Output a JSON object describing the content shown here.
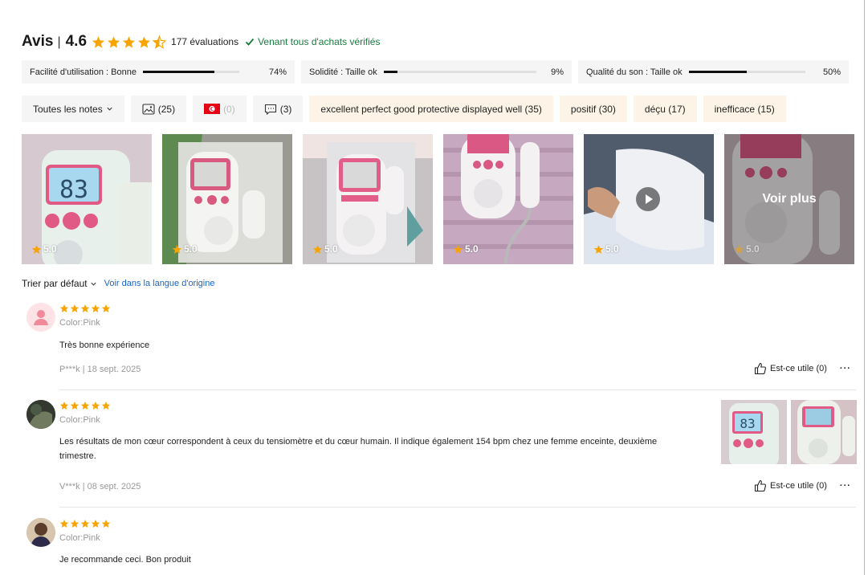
{
  "header": {
    "title": "Avis",
    "separator": "|",
    "score": "4.6",
    "count_text": "177 évaluations",
    "verified_text": "Venant tous d'achats vérifiés",
    "star_color": "#f7a400",
    "verified_color": "#187b3e"
  },
  "attributes": [
    {
      "label": "Facilité d'utilisation : Bonne",
      "percent": "74%",
      "level": 0.74
    },
    {
      "label": "Solidité : Taille ok",
      "percent": "9%",
      "level": 0.09
    },
    {
      "label": "Qualité du son : Taille ok",
      "percent": "50%",
      "level": 0.5
    }
  ],
  "filters": {
    "all_notes": "Toutes les notes",
    "photos_count": "(25)",
    "flag_count": "(0)",
    "comments_count": "(3)",
    "tags": [
      "excellent perfect good protective displayed well (35)",
      "positif (30)",
      "déçu (17)",
      "inefficace (15)"
    ]
  },
  "photos": [
    {
      "rating": "5.0"
    },
    {
      "rating": "5.0"
    },
    {
      "rating": "5.0"
    },
    {
      "rating": "5.0"
    },
    {
      "rating": "5.0"
    },
    {
      "rating": "5.0",
      "overlay": "Voir plus"
    }
  ],
  "photo_display_reading": "83",
  "sort": {
    "label": "Trier par défaut",
    "origin_lang": "Voir dans la langue d'origine"
  },
  "reviews": [
    {
      "color": "Color:Pink",
      "text": "Très bonne expérience",
      "meta": "P***k | 18 sept. 2025",
      "useful": "Est-ce utile (0)",
      "stars": 5
    },
    {
      "color": "Color:Pink",
      "text": "Les résultats de mon cœur correspondent à ceux du tensiomètre et du cœur humain. Il indique également 154 bpm chez une femme enceinte, deuxième trimestre.",
      "meta": "V***k | 08 sept. 2025",
      "useful": "Est-ce utile (0)",
      "stars": 5
    },
    {
      "color": "Color:Pink",
      "text": "Je recommande ceci. Bon produit",
      "stars": 5
    }
  ],
  "more_icon": "more-dots-icon"
}
